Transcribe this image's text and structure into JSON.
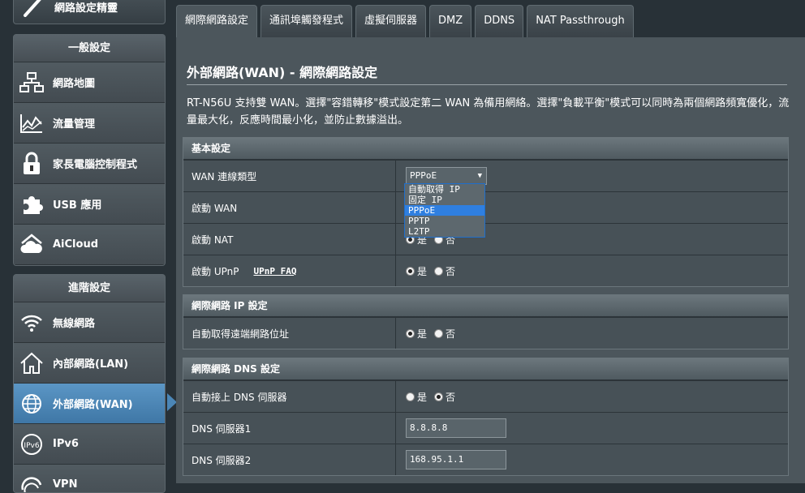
{
  "sidebar": {
    "top_item": {
      "label": "網路設定精靈",
      "icon": "wand-icon"
    },
    "general": {
      "title": "一般設定",
      "items": [
        {
          "label": "網路地圖",
          "icon": "network-map-icon"
        },
        {
          "label": "流量管理",
          "icon": "traffic-icon"
        },
        {
          "label": "家長電腦控制程式",
          "icon": "lock-icon"
        },
        {
          "label": "USB 應用",
          "icon": "puzzle-icon"
        },
        {
          "label": "AiCloud",
          "icon": "cloud-icon"
        }
      ]
    },
    "advanced": {
      "title": "進階設定",
      "items": [
        {
          "label": "無線網路",
          "icon": "wifi-icon"
        },
        {
          "label": "內部網路(LAN)",
          "icon": "home-icon"
        },
        {
          "label": "外部網路(WAN)",
          "icon": "globe-icon"
        },
        {
          "label": "IPv6",
          "icon": "ipv6-icon"
        },
        {
          "label": "VPN",
          "icon": "vpn-icon"
        }
      ]
    }
  },
  "tabs": [
    {
      "label": "網際網路設定",
      "active": true
    },
    {
      "label": "通訊埠觸發程式"
    },
    {
      "label": "虛擬伺服器"
    },
    {
      "label": "DMZ"
    },
    {
      "label": "DDNS"
    },
    {
      "label": "NAT Passthrough"
    }
  ],
  "page": {
    "title": "外部網路(WAN) - 網際網路設定",
    "description": "RT-N56U 支持雙 WAN。選擇\"容錯轉移\"模式設定第二 WAN 為備用網絡。選擇\"負載平衡\"模式可以同時為兩個網路頻寬優化，流量最大化，反應時間最小化，並防止數據溢出。"
  },
  "basic": {
    "title": "基本設定",
    "wan_type_label": "WAN 連線類型",
    "wan_type_value": "PPPoE",
    "wan_type_options": [
      "自動取得 IP",
      "固定 IP",
      "PPPoE",
      "PPTP",
      "L2TP"
    ],
    "enable_wan_label": "啟動 WAN",
    "enable_nat_label": "啟動 NAT",
    "enable_upnp_label": "啟動 UPnP",
    "upnp_faq": "UPnP  FAQ"
  },
  "radio": {
    "yes": "是",
    "no": "否"
  },
  "ip_setting": {
    "title": "網際網路 IP 設定",
    "auto_ip_label": "自動取得遠端網路位址"
  },
  "dns": {
    "title": "網際網路 DNS 設定",
    "auto_dns_label": "自動接上 DNS 伺服器",
    "dns1_label": "DNS 伺服器1",
    "dns1_value": "8.8.8.8",
    "dns2_label": "DNS 伺服器2",
    "dns2_value": "168.95.1.1"
  },
  "colors": {
    "active_nav": "#4b86b6",
    "panel": "#4c565c",
    "background": "#283137"
  }
}
